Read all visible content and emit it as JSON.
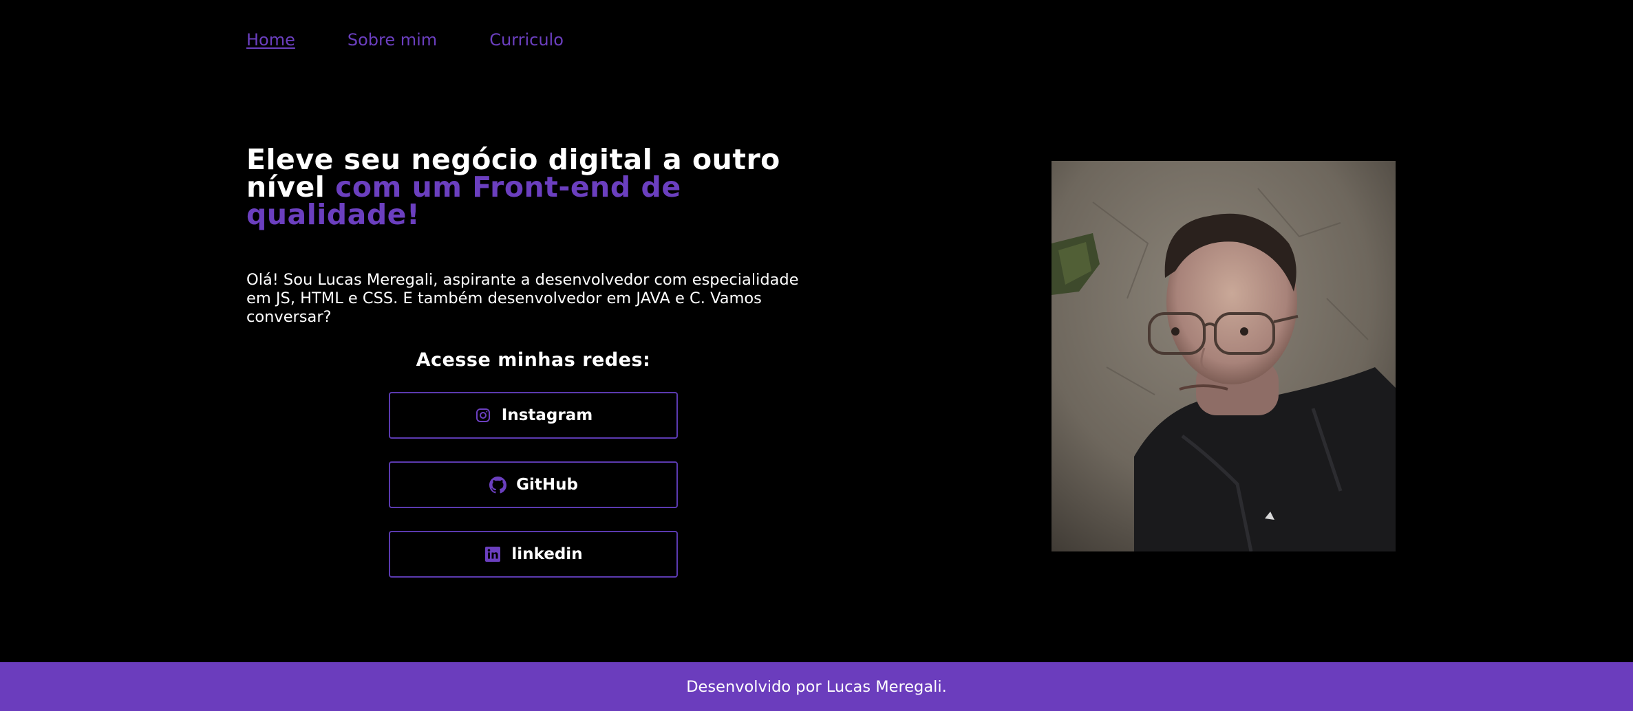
{
  "nav": {
    "items": [
      {
        "label": "Home",
        "active": true
      },
      {
        "label": "Sobre mim",
        "active": false
      },
      {
        "label": "Curriculo",
        "active": false
      }
    ]
  },
  "hero": {
    "headline_white": "Eleve seu negócio digital a outro nível",
    "headline_accent": "com um Front-end de qualidade!",
    "intro": "Olá! Sou Lucas Meregali, aspirante a desenvolvedor com especialidade em JS, HTML e CSS. E também desenvolvedor em JAVA e C. Vamos conversar?"
  },
  "socials": {
    "title": "Acesse minhas redes:",
    "buttons": [
      {
        "label": "Instagram",
        "icon": "instagram-icon"
      },
      {
        "label": "GitHub",
        "icon": "github-icon"
      },
      {
        "label": "linkedin",
        "icon": "linkedin-icon"
      }
    ]
  },
  "footer": {
    "text": "Desenvolvido por Lucas Meregali."
  },
  "colors": {
    "background": "#000000",
    "accent": "#6b3fbf",
    "footer": "#6b3dbd",
    "button_border": "#5b3ab0"
  }
}
